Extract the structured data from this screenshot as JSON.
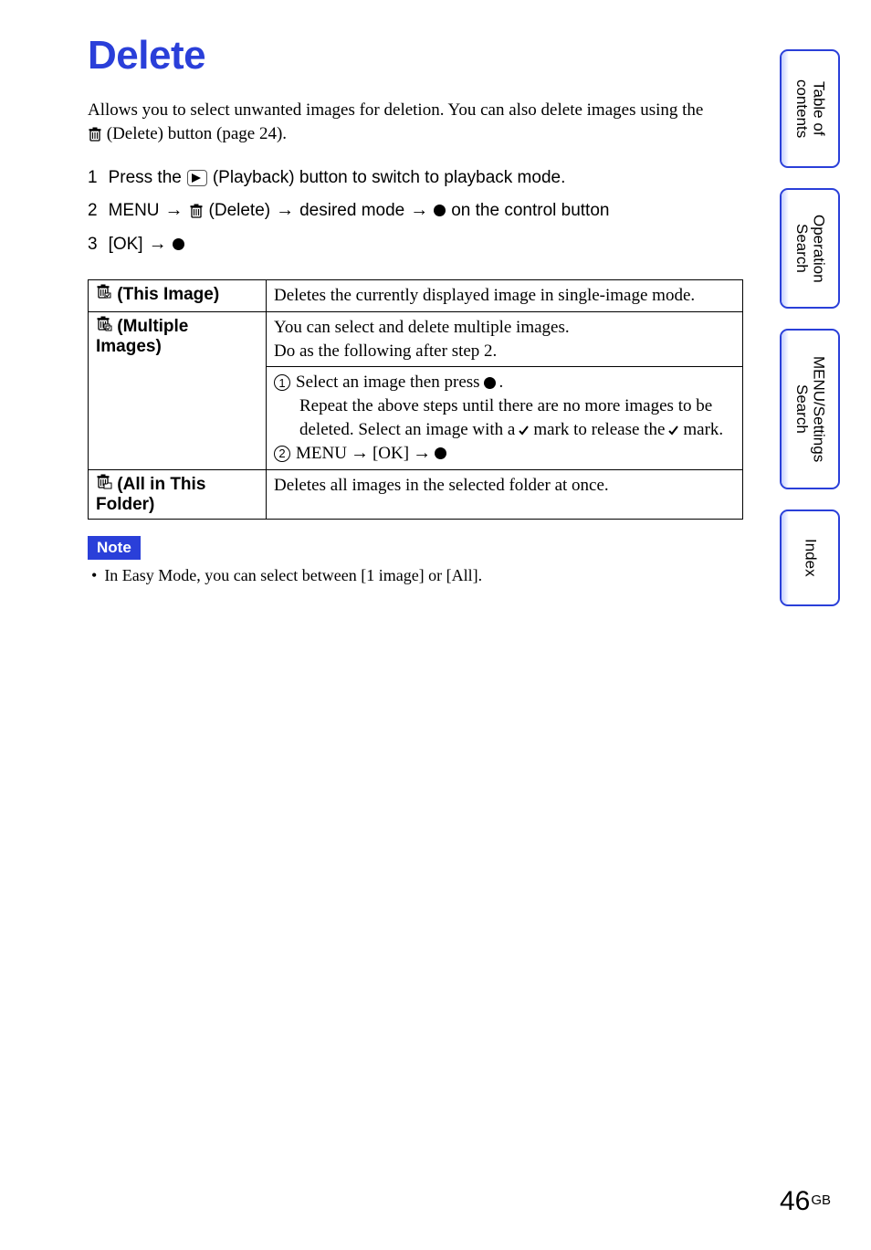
{
  "title": "Delete",
  "intro_line1": "Allows you to select unwanted images for deletion. You can also delete images using the",
  "intro_line2": " (Delete) button (page 24).",
  "steps": {
    "s1_num": "1",
    "s1_a": "Press the ",
    "s1_b": " (Playback) button to switch to playback mode.",
    "s2_num": "2",
    "s2_a": "MENU ",
    "s2_b": " (Delete) ",
    "s2_c": " desired mode ",
    "s2_d": " on the control button",
    "s3_num": "3",
    "s3_a": "[OK] "
  },
  "arrow": "→",
  "table": {
    "r1_label": " (This Image)",
    "r1_desc": "Deletes the currently displayed image in single-image mode.",
    "r2_label": " (Multiple Images)",
    "r2_desc_a": "You can select and delete multiple images.",
    "r2_desc_b": "Do as the following after step 2.",
    "r2_step1_pre": "Select an image then press ",
    "r2_step1_post": ".",
    "r2_step1_line2a": "Repeat the above steps until there are no more images to be",
    "r2_step1_line2b": "deleted. Select an image with a ",
    "r2_step1_line2c": " mark to release the ",
    "r2_step1_line2d": " mark.",
    "r2_step2_a": "MENU ",
    "r2_step2_b": " [OK] ",
    "r3_label_a": " (All in This",
    "r3_label_b": "Folder)",
    "r3_desc": "Deletes all images in the selected folder at once."
  },
  "enc1": "1",
  "enc2": "2",
  "note_title": "Note",
  "note_item": "In Easy Mode, you can select between [1 image] or [All].",
  "tabs": {
    "t1": "Table of contents",
    "t2": "Operation Search",
    "t3": "MENU/Settings Search",
    "t4": "Index"
  },
  "page_number": "46",
  "page_suffix": "GB"
}
